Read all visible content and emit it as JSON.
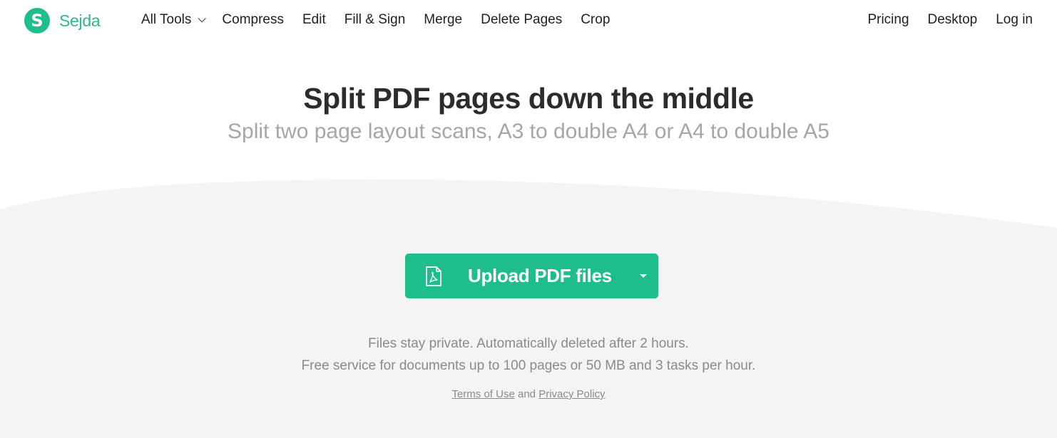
{
  "brand": {
    "name": "Sejda",
    "logo_letter": "S",
    "color": "#1fbd8c"
  },
  "nav": {
    "left": [
      {
        "label": "All Tools",
        "has_dropdown": true
      },
      {
        "label": "Compress"
      },
      {
        "label": "Edit"
      },
      {
        "label": "Fill & Sign"
      },
      {
        "label": "Merge"
      },
      {
        "label": "Delete Pages"
      },
      {
        "label": "Crop"
      }
    ],
    "right": [
      {
        "label": "Pricing"
      },
      {
        "label": "Desktop"
      },
      {
        "label": "Log in"
      }
    ]
  },
  "hero": {
    "title": "Split PDF pages down the middle",
    "subtitle": "Split two page layout scans, A3 to double A4 or A4 to double A5"
  },
  "upload": {
    "label": "Upload PDF files",
    "icon": "pdf-file-icon",
    "dropdown_icon": "caret-down-icon"
  },
  "info": {
    "line1": "Files stay private. Automatically deleted after 2 hours.",
    "line2": "Free service for documents up to 100 pages or 50 MB and 3 tasks per hour."
  },
  "legal": {
    "terms": "Terms of Use",
    "and": " and ",
    "privacy": "Privacy Policy"
  }
}
